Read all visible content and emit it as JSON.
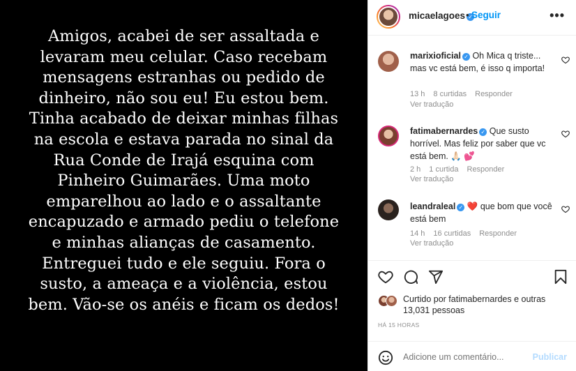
{
  "post": {
    "text_lines": [
      "Amigos, acabei de ser assaltada e",
      "levaram meu celular. Caso recebam",
      "mensagens estranhas ou pedido de",
      "dinheiro, não sou eu! Eu estou bem.",
      "Tinha acabado de deixar minhas filhas",
      "na escola e estava parada no sinal da",
      "Rua Conde de Irajá esquina com",
      "Pinheiro Guimarães. Uma moto",
      "emparelhou ao lado e o assaltante",
      "encapuzado e armado pediu o telefone",
      "e minhas alianças de casamento.",
      "Entreguei tudo e ele seguiu. Fora o",
      "susto, a ameaça e a violência, estou",
      "bem. Vão-se os anéis e ficam os dedos!"
    ]
  },
  "header": {
    "username": "micaelagoes",
    "separator": "•",
    "follow_label": "Seguir",
    "more_icon": "more-horizontal-icon"
  },
  "comments": [
    {
      "username": "marixioficial",
      "text": "Oh Mica q triste... mas vc está bem, é isso q importa!",
      "time": "13 h",
      "likes": "8 curtidas",
      "reply": "Responder",
      "translate": "Ver tradução",
      "avatar_color": "#b07a6a"
    },
    {
      "username": "fatimabernardes",
      "text": "Que susto horrível. Mas feliz por saber que vc está bem. 🙏🏻 💕",
      "time": "2 h",
      "likes": "1 curtida",
      "reply": "Responder",
      "translate": "Ver tradução",
      "avatar_color": "#8a4a3a"
    },
    {
      "username": "leandraleal",
      "text": "❤️ que bom que você está bem",
      "time": "14 h",
      "likes": "16 curtidas",
      "reply": "Responder",
      "translate": "Ver tradução",
      "avatar_color": "#3a2e28"
    }
  ],
  "likes": {
    "text": "Curtido por fatimabernardes e outras 13,031 pessoas"
  },
  "time_ago": "HÁ 15 HORAS",
  "add_comment": {
    "placeholder": "Adicione um comentário...",
    "publish_label": "Publicar"
  },
  "colors": {
    "accent": "#0095f6",
    "verified": "#3897f0",
    "muted": "#8e8e8e",
    "publish_disabled": "#b3dbff"
  }
}
